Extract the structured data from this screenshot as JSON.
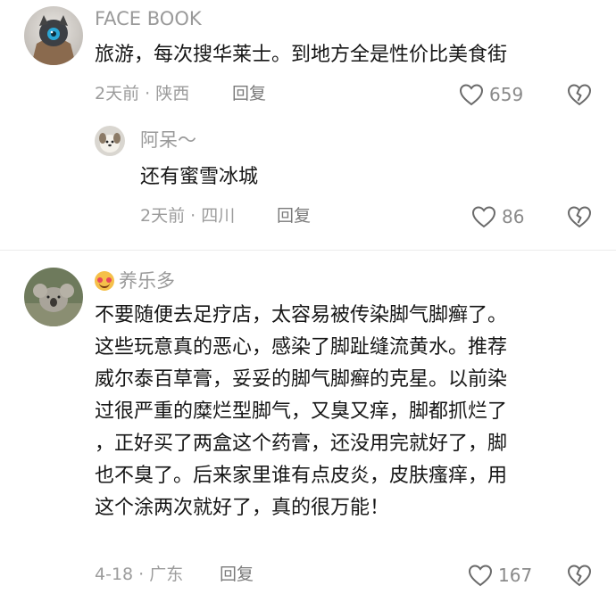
{
  "comments": [
    {
      "username": "FACE BOOK",
      "text": "旅游，每次搜华莱士。到地方全是性价比美食街",
      "meta": "2天前 · 陕西",
      "reply_label": "回复",
      "like_count": "659",
      "replies": [
        {
          "username": "阿呆～",
          "text": "还有蜜雪冰城",
          "meta": "2天前 · 四川",
          "reply_label": "回复",
          "like_count": "86"
        }
      ]
    },
    {
      "username": "养乐多",
      "username_emoji": "smiling-face-with-hearts",
      "text_lines": [
        "不要随便去足疗店，太容易被传染脚气脚癣了。",
        "这些玩意真的恶心，感染了脚趾缝流黄水。推荐",
        "威尔泰百草膏，妥妥的脚气脚癣的克星。以前染",
        "过很严重的糜烂型脚气，又臭又痒，脚都抓烂了",
        "，正好买了两盒这个药膏，还没用完就好了，脚",
        "也不臭了。后来家里谁有点皮炎，皮肤瘙痒，用",
        "这个涂两次就好了，真的很万能！"
      ],
      "meta": "4-18 · 广东",
      "reply_label": "回复",
      "like_count": "167"
    }
  ],
  "icons": {
    "like": "heart-outline-icon",
    "dislike": "broken-heart-icon"
  },
  "colors": {
    "text": "#161616",
    "username": "#9a9a9a",
    "meta": "#9c9c9c",
    "icon": "#6a6a6a"
  }
}
